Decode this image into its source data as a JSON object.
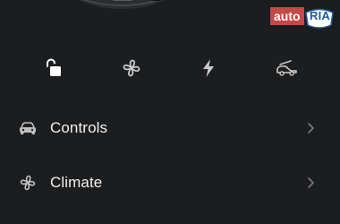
{
  "watermark": {
    "auto": "auto",
    "ria": "RIA"
  },
  "quick_controls": [
    {
      "icon": "unlock-icon"
    },
    {
      "icon": "fan-icon"
    },
    {
      "icon": "bolt-icon"
    },
    {
      "icon": "frunk-icon"
    }
  ],
  "menu": {
    "items": [
      {
        "label": "Controls",
        "icon": "car-icon"
      },
      {
        "label": "Climate",
        "icon": "fan-icon"
      }
    ]
  },
  "colors": {
    "background": "#1c1d1f",
    "icon_active": "#ffffff",
    "icon_muted": "#c9c9c9",
    "chevron": "#7a7b7e",
    "watermark_red": "#c44a48",
    "watermark_blue": "#1d59a7"
  }
}
